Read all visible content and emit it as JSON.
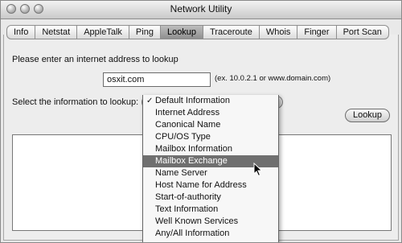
{
  "window": {
    "title": "Network Utility"
  },
  "tabs": [
    "Info",
    "Netstat",
    "AppleTalk",
    "Ping",
    "Lookup",
    "Traceroute",
    "Whois",
    "Finger",
    "Port Scan"
  ],
  "activeTab": "Lookup",
  "lookup": {
    "prompt": "Please enter an internet address to lookup",
    "address_value": "osxit.com",
    "example": "(ex. 10.0.2.1 or www.domain.com)",
    "select_label": "Select the information to lookup:",
    "lookup_button": "Lookup",
    "menu": {
      "items": [
        "Default Information",
        "Internet Address",
        "Canonical Name",
        "CPU/OS Type",
        "Mailbox Information",
        "Mailbox Exchange",
        "Name Server",
        "Host Name for Address",
        "Start-of-authority",
        "Text Information",
        "Well Known Services",
        "Any/All Information"
      ],
      "checked_item": "Default Information",
      "highlighted_item": "Mailbox Exchange"
    }
  }
}
